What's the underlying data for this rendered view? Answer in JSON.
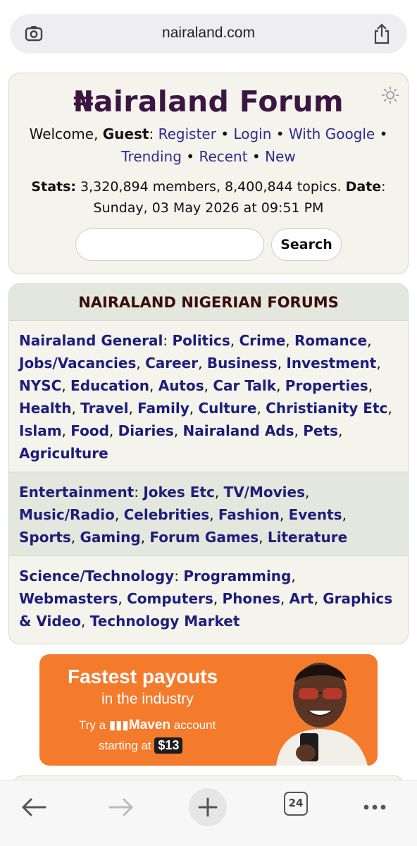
{
  "browser": {
    "url": "nairaland.com",
    "tab_count": "24"
  },
  "header": {
    "title": "₦airaland Forum",
    "welcome_prefix": "Welcome, ",
    "guest": "Guest",
    "colon": ": ",
    "register": "Register",
    "login": "Login",
    "with_google": "With Google",
    "trending": "Trending",
    "recent": "Recent",
    "new": "New",
    "bullet": " • ",
    "stats_label": "Stats:",
    "stats_value": " 3,320,894 members, 8,400,844 topics. ",
    "date_label": "Date",
    "date_value": "Sunday, 03 May 2026 at 09:51 PM",
    "search_placeholder": "",
    "search_button": "Search"
  },
  "forums": {
    "heading": "NAIRALAND NIGERIAN FORUMS",
    "sections": [
      {
        "category": "Nairaland General",
        "links": [
          "Politics",
          "Crime",
          "Romance",
          "Jobs/Vacancies",
          "Career",
          "Business",
          "Investment",
          "NYSC",
          "Education",
          "Autos",
          "Car Talk",
          "Properties",
          "Health",
          "Travel",
          "Family",
          "Culture",
          "Christianity Etc",
          "Islam",
          "Food",
          "Diaries",
          "Nairaland Ads",
          "Pets",
          "Agriculture"
        ]
      },
      {
        "category": "Entertainment",
        "links": [
          "Jokes Etc",
          "TV/Movies",
          "Music/Radio",
          "Celebrities",
          "Fashion",
          "Events",
          "Sports",
          "Gaming",
          "Forum Games",
          "Literature"
        ]
      },
      {
        "category": "Science/Technology",
        "links": [
          "Programming",
          "Webmasters",
          "Computers",
          "Phones",
          "Art",
          "Graphics & Video",
          "Technology Market"
        ]
      }
    ]
  },
  "ad": {
    "line1": "Fastest payouts",
    "line2": "in the industry",
    "line3_pre": "Try a ",
    "brand": "Maven",
    "line3_post": " account",
    "line4_pre": "starting at ",
    "price": "$13"
  },
  "icons": {
    "lens": "lens-icon",
    "share": "share-icon",
    "theme": "sun-icon",
    "back": "back-arrow-icon",
    "forward": "forward-arrow-icon",
    "new_tab": "plus-icon",
    "tabs": "tabs-icon",
    "more": "more-dots-icon"
  },
  "colors": {
    "title": "#3b1643",
    "link": "#1d1d7a",
    "card_bg": "#f4f3ec",
    "ad_bg": "#f47a2c"
  }
}
